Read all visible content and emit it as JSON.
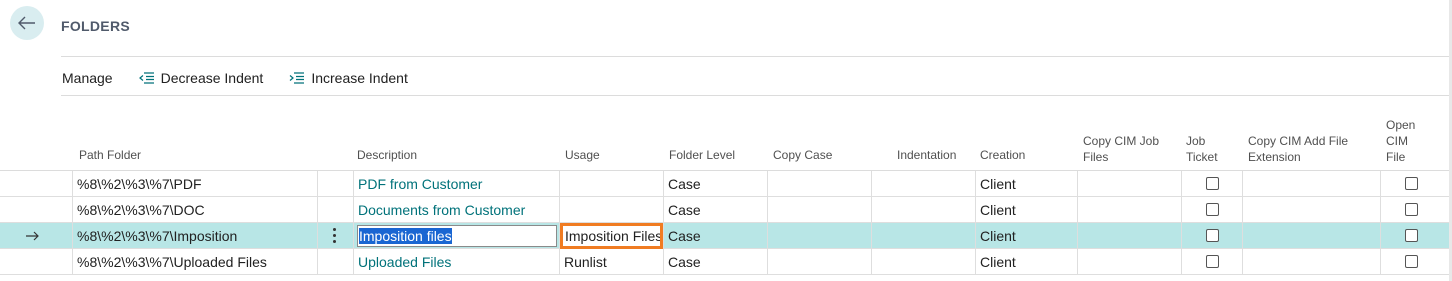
{
  "header": {
    "title": "FOLDERS",
    "back_label": "Back"
  },
  "toolbar": {
    "manage_label": "Manage",
    "decrease_indent_label": "Decrease Indent",
    "increase_indent_label": "Increase Indent"
  },
  "columns": {
    "path_folder": "Path Folder",
    "description": "Description",
    "usage": "Usage",
    "folder_level": "Folder Level",
    "copy_case": "Copy Case",
    "indentation": "Indentation",
    "creation": "Creation",
    "copy_cim_job_files_l1": "Copy CIM Job",
    "copy_cim_job_files_l2": "Files",
    "job_ticket_l1": "Job",
    "job_ticket_l2": "Ticket",
    "copy_cim_add_file_ext_l1": "Copy CIM Add File",
    "copy_cim_add_file_ext_l2": "Extension",
    "open_cim_file_l1": "Open",
    "open_cim_file_l2": "CIM",
    "open_cim_file_l3": "File"
  },
  "rows": [
    {
      "path": "%8\\%2\\%3\\%7\\PDF",
      "description": "PDF from Customer",
      "usage": "",
      "folder_level": "Case",
      "creation": "Client",
      "job_ticket": false,
      "open_cim_file": false
    },
    {
      "path": "%8\\%2\\%3\\%7\\DOC",
      "description": "Documents from Customer",
      "usage": "",
      "folder_level": "Case",
      "creation": "Client",
      "job_ticket": false,
      "open_cim_file": false
    },
    {
      "path": "%8\\%2\\%3\\%7\\Imposition",
      "description": "Imposition files",
      "usage": "Imposition Files",
      "folder_level": "Case",
      "creation": "Client",
      "job_ticket": false,
      "open_cim_file": false,
      "selected": true
    },
    {
      "path": "%8\\%2\\%3\\%7\\Uploaded Files",
      "description": "Uploaded Files",
      "usage": "Runlist",
      "folder_level": "Case",
      "creation": "Client",
      "job_ticket": false,
      "open_cim_file": false
    }
  ],
  "colors": {
    "accent": "#00727a",
    "selected_row": "#b8e6e6",
    "highlight": "#f07c22",
    "selection": "#1a66d2"
  },
  "icons": {
    "back": "arrow-left-icon",
    "row_marker": "arrow-right-icon",
    "decrease": "decrease-indent-icon",
    "increase": "increase-indent-icon",
    "row_menu": "kebab-menu-icon"
  }
}
